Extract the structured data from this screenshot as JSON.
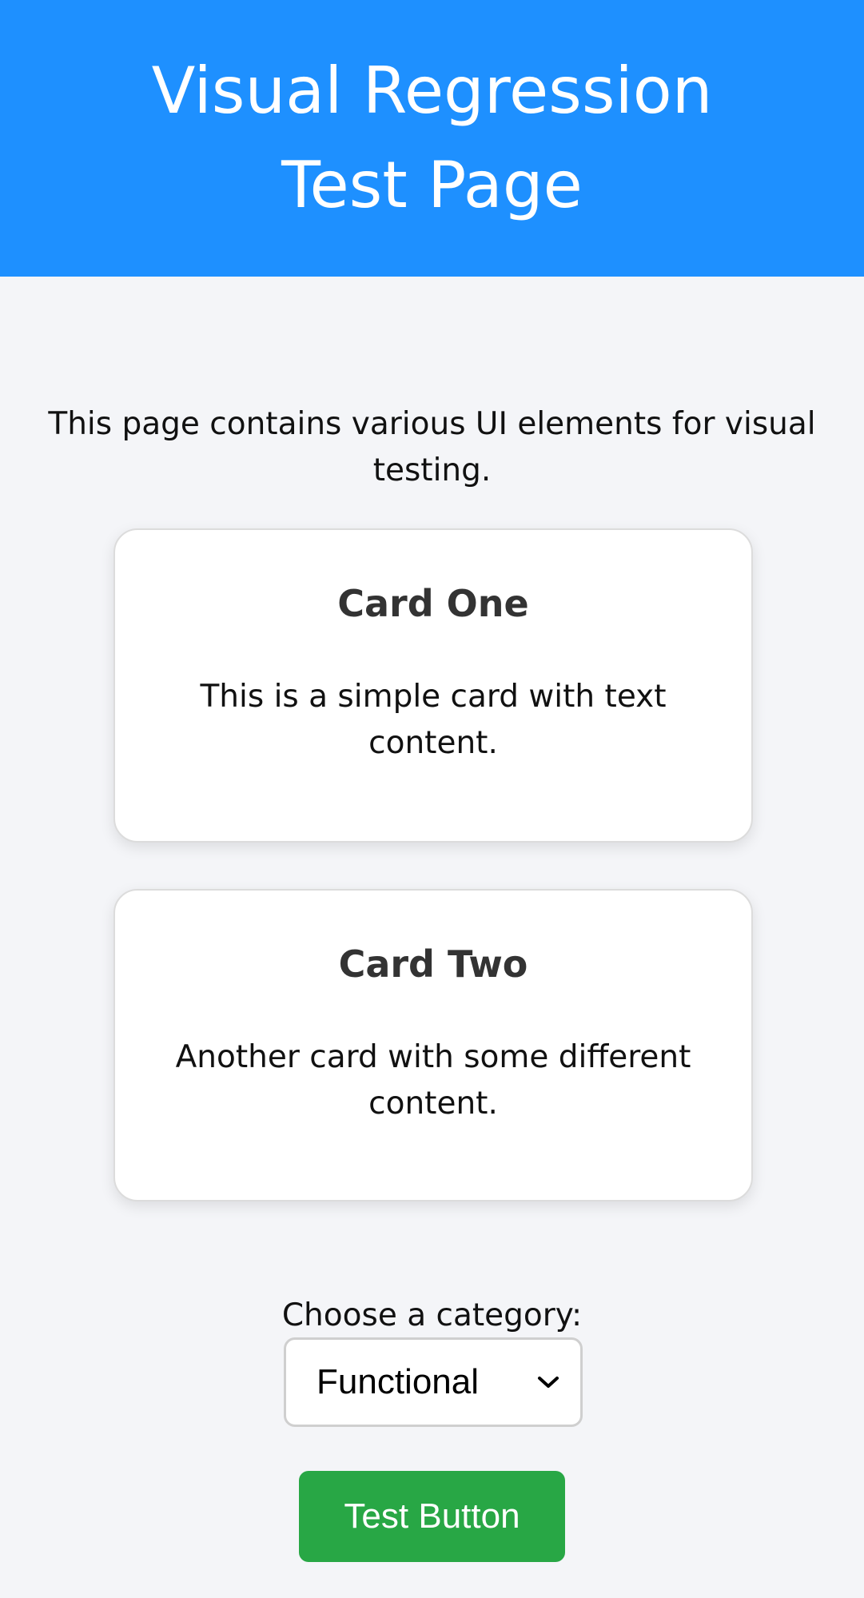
{
  "header": {
    "title": "Visual Regression Test Page",
    "background_color": "#1e90ff"
  },
  "intro": {
    "text": "This page contains various UI elements for visual testing."
  },
  "cards": [
    {
      "title": "Card One",
      "body": "This is a simple card with text content."
    },
    {
      "title": "Card Two",
      "body": "Another card with some different content."
    }
  ],
  "category_select": {
    "label": "Choose a category:",
    "selected": "Functional",
    "icon": "chevron-down-icon"
  },
  "test_button": {
    "label": "Test Button",
    "color": "#28a745"
  }
}
